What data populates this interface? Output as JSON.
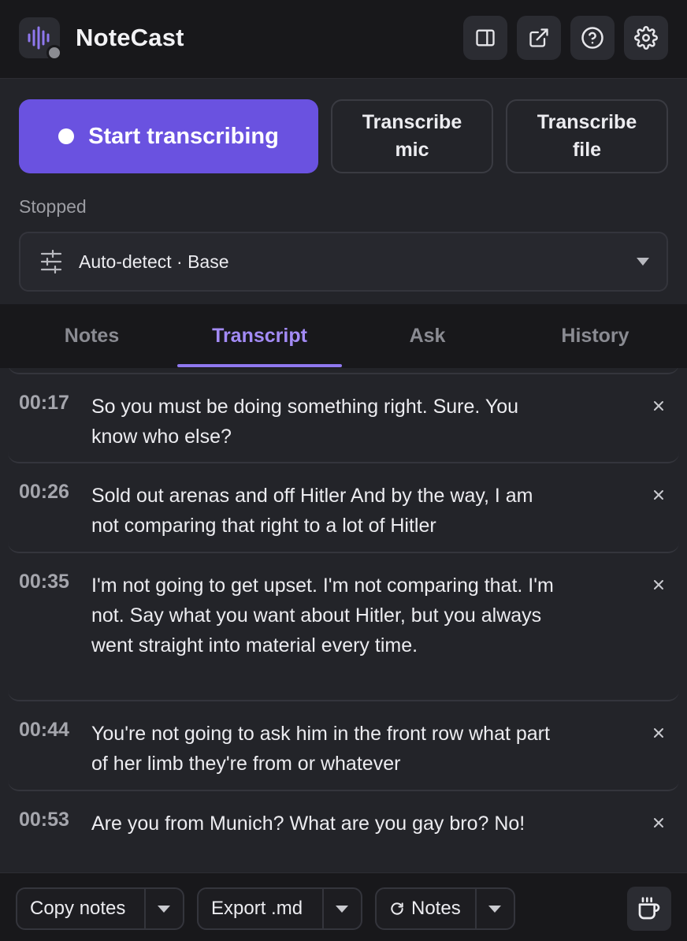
{
  "app": {
    "title": "NoteCast",
    "logo_icon": "waveform-icon",
    "header_icons": [
      "sidebar-panel-icon",
      "external-link-icon",
      "help-icon",
      "gear-icon"
    ]
  },
  "controls": {
    "start_label": "Start transcribing",
    "mic_label": "Transcribe mic",
    "file_label": "Transcribe file",
    "status": "Stopped",
    "language_select": "Auto-detect · Base"
  },
  "tabs": [
    {
      "label": "Notes"
    },
    {
      "label": "Transcript",
      "active": true
    },
    {
      "label": "Ask"
    },
    {
      "label": "History"
    }
  ],
  "transcript": [
    {
      "time": "00:17",
      "text": "So you must be doing something right. Sure. You know who else?"
    },
    {
      "time": "00:26",
      "text": "Sold out arenas and off Hitler And by the way, I am not comparing that right to a lot of Hitler"
    },
    {
      "time": "00:35",
      "text": "I'm not going to get upset. I'm not comparing that. I'm not. Say what you want about Hitler, but you always went straight into material every time."
    },
    {
      "time": "00:44",
      "text": "You're not going to ask him in the front row what part of her limb they're from or whatever"
    },
    {
      "time": "00:53",
      "text": "Are you from Munich? What are you gay bro? No!"
    }
  ],
  "footer": {
    "copy_label": "Copy notes",
    "export_label": "Export .md",
    "notes_label": "Notes",
    "notes_icon": "refresh-icon",
    "coffee_icon": "coffee-icon"
  },
  "colors": {
    "accent": "#6a52e0",
    "active_tab": "#a38bf5",
    "background": "#232429",
    "header": "#18181b"
  }
}
